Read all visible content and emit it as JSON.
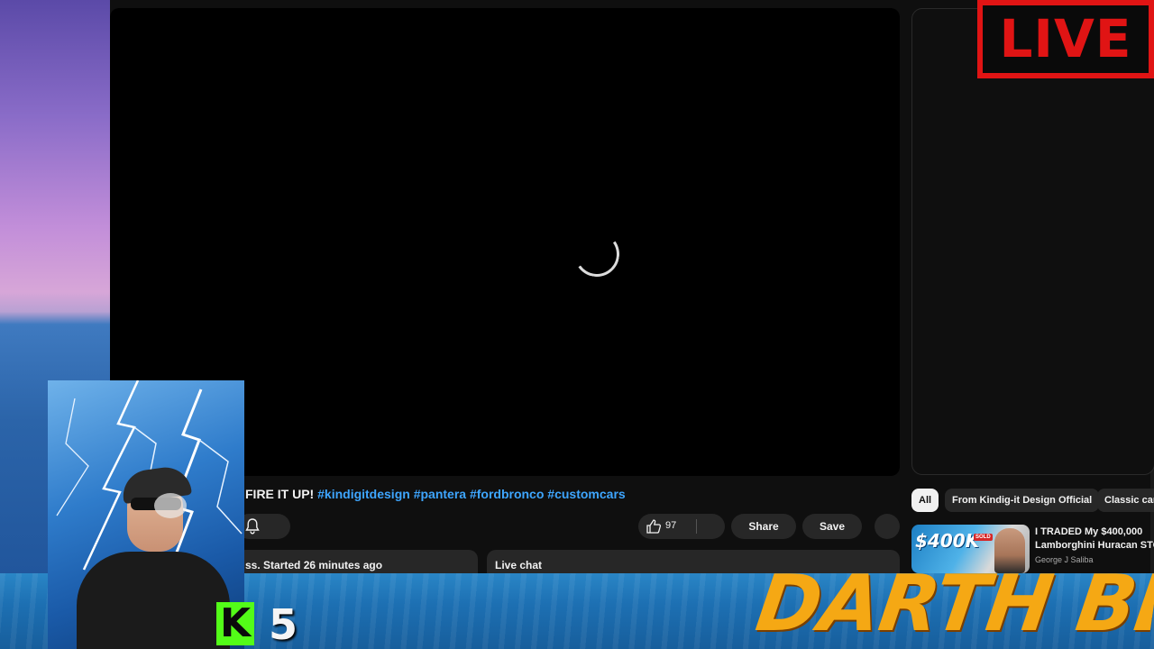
{
  "live_badge": {
    "label": "LIVE"
  },
  "video": {
    "title_prefix": "FIRE IT UP!",
    "hashtags": [
      "#kindigitdesign",
      "#pantera",
      "#fordbronco",
      "#customcars"
    ],
    "like_count": "97",
    "share_label": "Share",
    "save_label": "Save",
    "description_preview": "ss. Started 26 minutes ago",
    "live_chat_label": "Live chat"
  },
  "chips": {
    "all": "All",
    "from": "From Kindig-it Design Official",
    "classic": "Classic cars"
  },
  "recommended": {
    "thumb_price": "$400K",
    "thumb_sold": "SOLD",
    "title_line1": "I TRADED My $400,000",
    "title_line2": "Lamborghini Huracan STO",
    "channel": "George J Saliba"
  },
  "overlay": {
    "kick_letter": "K",
    "viewer_count": "5",
    "streamer_name": "DARTH BLAZE"
  },
  "colors": {
    "live_red": "#e01414",
    "hashtag_blue": "#3ea6ff",
    "kick_green": "#53fc18",
    "name_orange": "#f5a814"
  }
}
